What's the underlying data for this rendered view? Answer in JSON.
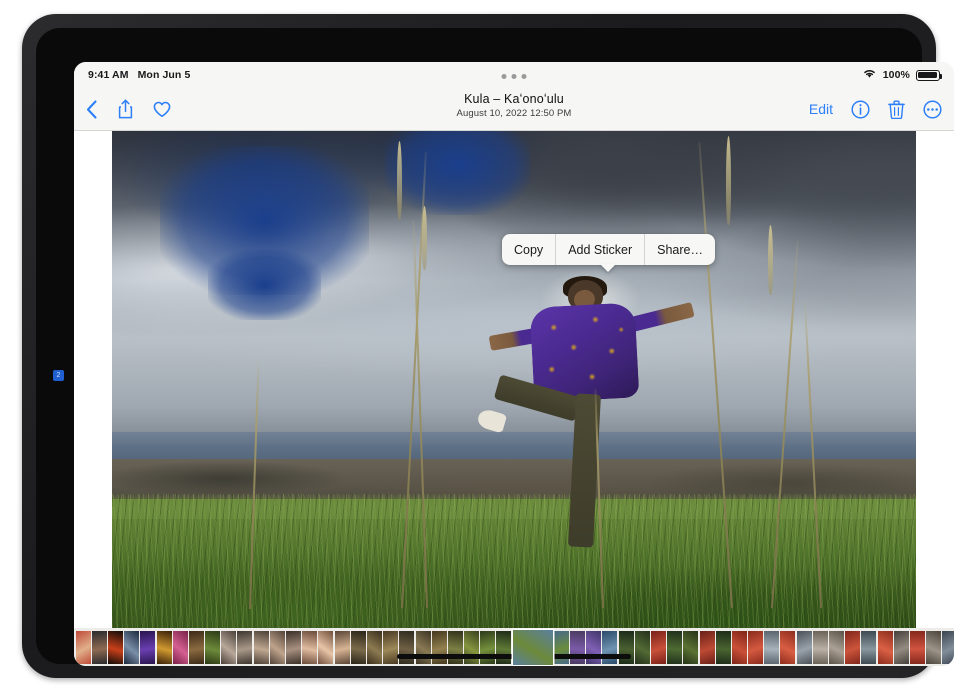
{
  "status_bar": {
    "time": "9:41 AM",
    "date": "Mon Jun 5",
    "battery_percent": "100%",
    "wifi_icon": "wifi-icon",
    "battery_icon": "battery-full-icon"
  },
  "nav_bar": {
    "back_icon": "chevron-left-icon",
    "share_icon": "share-icon",
    "favorite_icon": "heart-outline-icon",
    "title": "Kula – Kaʻonoʻulu",
    "subtitle": "August 10, 2022  12:50 PM",
    "edit_label": "Edit",
    "info_icon": "info-circle-icon",
    "delete_icon": "trash-icon",
    "more_icon": "ellipsis-circle-icon"
  },
  "context_menu": {
    "items": [
      {
        "label": "Copy"
      },
      {
        "label": "Add Sticker"
      },
      {
        "label": "Share…"
      }
    ]
  },
  "photo": {
    "description": "Person in purple and gold floral shirt balancing on one leg in a tall grass field under dramatic storm clouds, ocean and distant land on the horizon",
    "alt": "Kula – Kaʻonoʻulu photo"
  },
  "filmstrip": {
    "selected_index": 27,
    "thumbnails": [
      {
        "c1": "#c04a3a",
        "c2": "#e0b08a"
      },
      {
        "c1": "#2b2b2f",
        "c2": "#8d6a52"
      },
      {
        "c1": "#120c08",
        "c2": "#c8401a"
      },
      {
        "c1": "#1b2a3e",
        "c2": "#7a8fa8"
      },
      {
        "c1": "#2a1550",
        "c2": "#6a3fb0"
      },
      {
        "c1": "#3a2008",
        "c2": "#d09a30"
      },
      {
        "c1": "#7a1f4a",
        "c2": "#d46090"
      },
      {
        "c1": "#3c2a18",
        "c2": "#8a6a40"
      },
      {
        "c1": "#2c3a16",
        "c2": "#6d8a3a"
      },
      {
        "c1": "#4a4038",
        "c2": "#b8a89a"
      },
      {
        "c1": "#3e3630",
        "c2": "#a89888"
      },
      {
        "c1": "#4c4038",
        "c2": "#c0a890"
      },
      {
        "c1": "#524238",
        "c2": "#bfa48c"
      },
      {
        "c1": "#3a3028",
        "c2": "#a89080"
      },
      {
        "c1": "#6a4a3a",
        "c2": "#e0bca0"
      },
      {
        "c1": "#70503c",
        "c2": "#e8c4a8"
      },
      {
        "c1": "#5a4636",
        "c2": "#d8b494"
      },
      {
        "c1": "#2a2418",
        "c2": "#7a6a4a"
      },
      {
        "c1": "#3a2e1c",
        "c2": "#8c7a50"
      },
      {
        "c1": "#4a3a24",
        "c2": "#9c8858"
      },
      {
        "c1": "#2e2a1e",
        "c2": "#706044"
      },
      {
        "c1": "#3c3424",
        "c2": "#8a7a54"
      },
      {
        "c1": "#44381f",
        "c2": "#93814f"
      },
      {
        "c1": "#30301a",
        "c2": "#7c8044"
      },
      {
        "c1": "#384020",
        "c2": "#86963e"
      },
      {
        "c1": "#2c3a1a",
        "c2": "#74903c"
      },
      {
        "c1": "#1e2a18",
        "c2": "#5f7a36"
      },
      {
        "c1": "#5a7f9f",
        "c2": "#6d8a3a"
      },
      {
        "c1": "#486a8a",
        "c2": "#6a8c3c"
      },
      {
        "c1": "#4a3a60",
        "c2": "#7a5aa8"
      },
      {
        "c1": "#40356a",
        "c2": "#8060b4"
      },
      {
        "c1": "#2a4a6a",
        "c2": "#6f93b0"
      },
      {
        "c1": "#1c2a1a",
        "c2": "#4a6030"
      },
      {
        "c1": "#24301c",
        "c2": "#536a34"
      },
      {
        "c1": "#7a2018",
        "c2": "#c8503a"
      },
      {
        "c1": "#20301c",
        "c2": "#4e6a32"
      },
      {
        "c1": "#263218",
        "c2": "#5a7232"
      },
      {
        "c1": "#6a2018",
        "c2": "#bc4a34"
      },
      {
        "c1": "#1e2c1a",
        "c2": "#4a6430"
      },
      {
        "c1": "#7e2418",
        "c2": "#ca5038"
      },
      {
        "c1": "#8a2a1c",
        "c2": "#d45a40"
      },
      {
        "c1": "#5a646e",
        "c2": "#a8b2ba"
      },
      {
        "c1": "#8e2c1e",
        "c2": "#d85e42"
      },
      {
        "c1": "#4a5058",
        "c2": "#98a2aa"
      },
      {
        "c1": "#6a6258",
        "c2": "#bab0a4"
      },
      {
        "c1": "#5a5248",
        "c2": "#aaa094"
      },
      {
        "c1": "#80261a",
        "c2": "#cc543c"
      },
      {
        "c1": "#3e4a52",
        "c2": "#8a969e"
      },
      {
        "c1": "#8c2e1e",
        "c2": "#da6044"
      },
      {
        "c1": "#44403a",
        "c2": "#948c82"
      },
      {
        "c1": "#86281c",
        "c2": "#d05440"
      },
      {
        "c1": "#4a443c",
        "c2": "#9c9488"
      },
      {
        "c1": "#3a4450",
        "c2": "#828e9a"
      },
      {
        "c1": "#2e3a46",
        "c2": "#6e7e8c"
      },
      {
        "c1": "#c8641c",
        "c2": "#f0a040"
      }
    ]
  },
  "home_indicator": {
    "label": "home-indicator"
  },
  "callout": {
    "number": "2"
  }
}
